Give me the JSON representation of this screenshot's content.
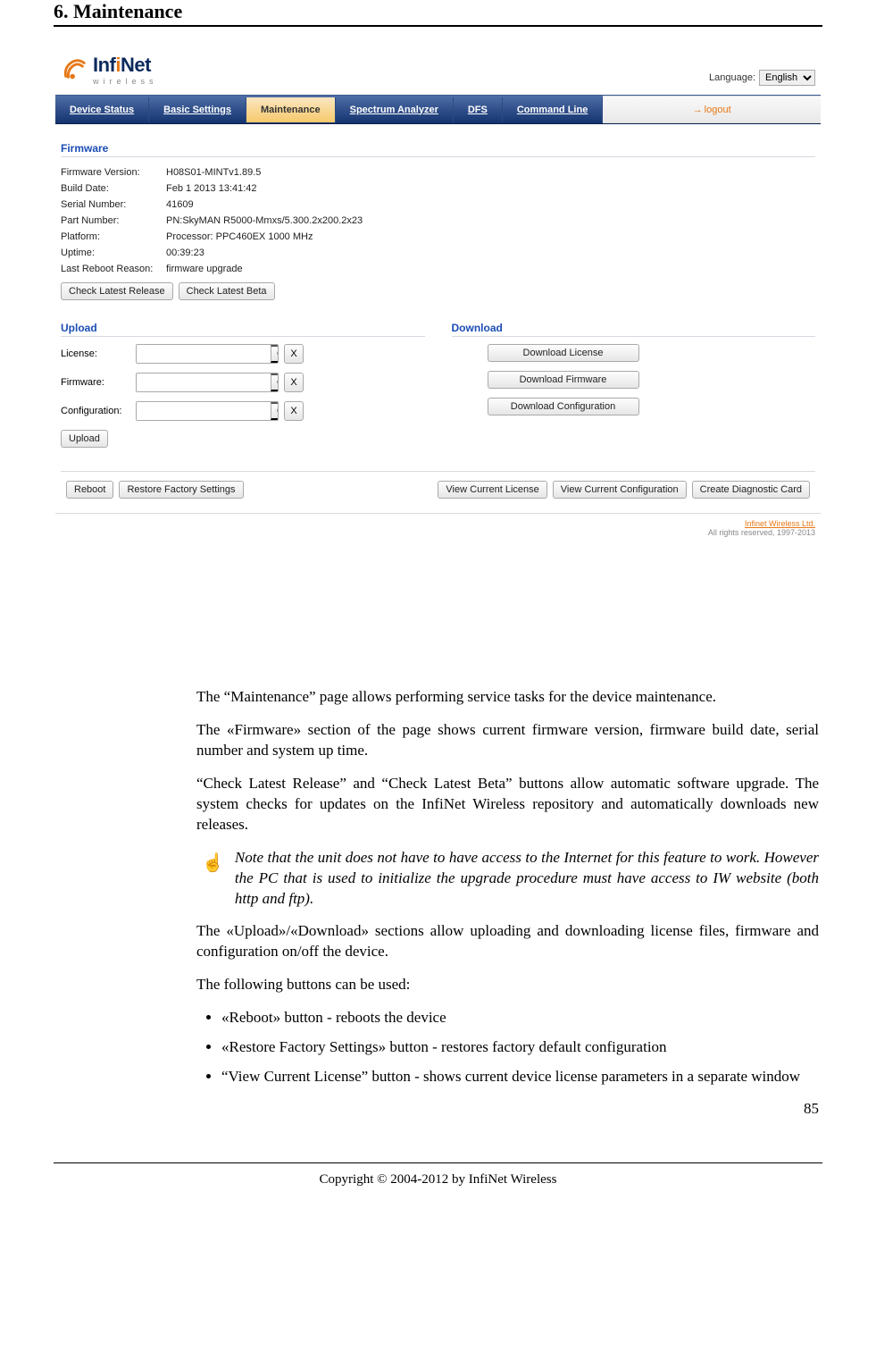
{
  "header": {
    "title": "6. Maintenance"
  },
  "shot": {
    "logo": {
      "brand_prefix": "Inf",
      "brand_mid": "i",
      "brand_suffix": "Net",
      "sub": "wireless"
    },
    "lang_label": "Language:",
    "lang_value": "English",
    "tabs": [
      "Device Status",
      "Basic Settings",
      "Maintenance",
      "Spectrum Analyzer",
      "DFS",
      "Command Line"
    ],
    "logout": "logout",
    "firmware_title": "Firmware",
    "rows": [
      {
        "label": "Firmware Version:",
        "val": "H08S01-MINTv1.89.5"
      },
      {
        "label": "Build Date:",
        "val": "Feb 1 2013 13:41:42"
      },
      {
        "label": "Serial Number:",
        "val": "41609"
      },
      {
        "label": "Part Number:",
        "val": "PN:SkyMAN R5000-Mmxs/5.300.2x200.2x23"
      },
      {
        "label": "Platform:",
        "val": "Processor: PPC460EX 1000 MHz"
      },
      {
        "label": "Uptime:",
        "val": "00:39:23"
      },
      {
        "label": "Last Reboot Reason:",
        "val": "firmware upgrade"
      }
    ],
    "check_release": "Check Latest Release",
    "check_beta": "Check Latest Beta",
    "upload_title": "Upload",
    "download_title": "Download",
    "up_labels": {
      "license": "License:",
      "firmware": "Firmware:",
      "config": "Configuration:"
    },
    "browse": "Обзор…",
    "x": "X",
    "upload_btn": "Upload",
    "dl_license": "Download License",
    "dl_firmware": "Download Firmware",
    "dl_config": "Download Configuration",
    "reboot": "Reboot",
    "restore": "Restore Factory Settings",
    "view_lic": "View Current License",
    "view_cfg": "View Current Configuration",
    "diag": "Create Diagnostic Card",
    "footer_link": "Infinet Wireless Ltd.",
    "footer_copy": "All rights reserved, 1997-2013"
  },
  "doc": {
    "p1": "The “Maintenance” page allows performing service tasks for the device maintenance.",
    "p2": "The «Firmware» section of the page shows current firmware version, firmware build date, serial number and system up time.",
    "p3": "“Check Latest Release” and “Check Latest Beta” buttons allow automatic software upgrade. The system checks for updates on the InfiNet Wireless repository and automatically downloads new releases.",
    "note": "Note that the unit does not have to have access to the Internet for this feature to work. However the PC that is used to initialize the upgrade procedure must have access to IW website (both http and ftp).",
    "p4": " The «Upload»/«Download» sections allow uploading and downloading license files, firmware and configuration on/off the device.",
    "p5": "The following buttons can be used:",
    "li1": "«Reboot» button - reboots the device",
    "li2": "«Restore Factory Settings» button - restores factory default configuration",
    "li3": "“View Current License” button - shows current device license parameters in a separate window",
    "page_num": "85"
  },
  "footer": "Copyright © 2004-2012 by InfiNet Wireless"
}
